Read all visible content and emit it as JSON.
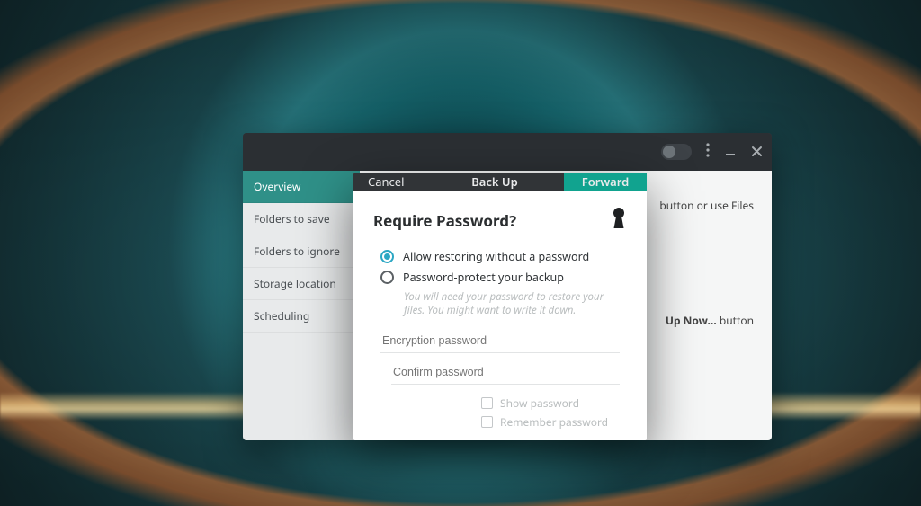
{
  "colors": {
    "accent_teal": "#11a38f",
    "radio_blue": "#2ca7c4",
    "titlebar": "#2b2f33"
  },
  "app": {
    "titlebar": {
      "toggle_state": "off",
      "menu_icon": "kebab-icon",
      "minimize_icon": "minimize-icon",
      "close_icon": "close-icon"
    },
    "sidebar": {
      "items": [
        {
          "label": "Overview",
          "active": true
        },
        {
          "label": "Folders to save",
          "active": false
        },
        {
          "label": "Folders to ignore",
          "active": false
        },
        {
          "label": "Storage location",
          "active": false
        },
        {
          "label": "Scheduling",
          "active": false
        }
      ]
    },
    "content": {
      "hint1_suffix": "button or use Files",
      "hint2_prefix_bold": "Up Now…",
      "hint2_suffix": " button"
    }
  },
  "dialog": {
    "cancel_label": "Cancel",
    "title": "Back Up",
    "forward_label": "Forward",
    "heading": "Require Password?",
    "keyhole_icon": "keyhole-icon",
    "options": {
      "allow": {
        "label": "Allow restoring without a password",
        "checked": true
      },
      "protect": {
        "label": "Password-protect your backup",
        "checked": false
      }
    },
    "protect_help": "You will need your password to restore your files. You might want to write it down.",
    "encryption_placeholder": "Encryption password",
    "confirm_placeholder": "Confirm password",
    "show_password_label": "Show password",
    "remember_password_label": "Remember password"
  }
}
